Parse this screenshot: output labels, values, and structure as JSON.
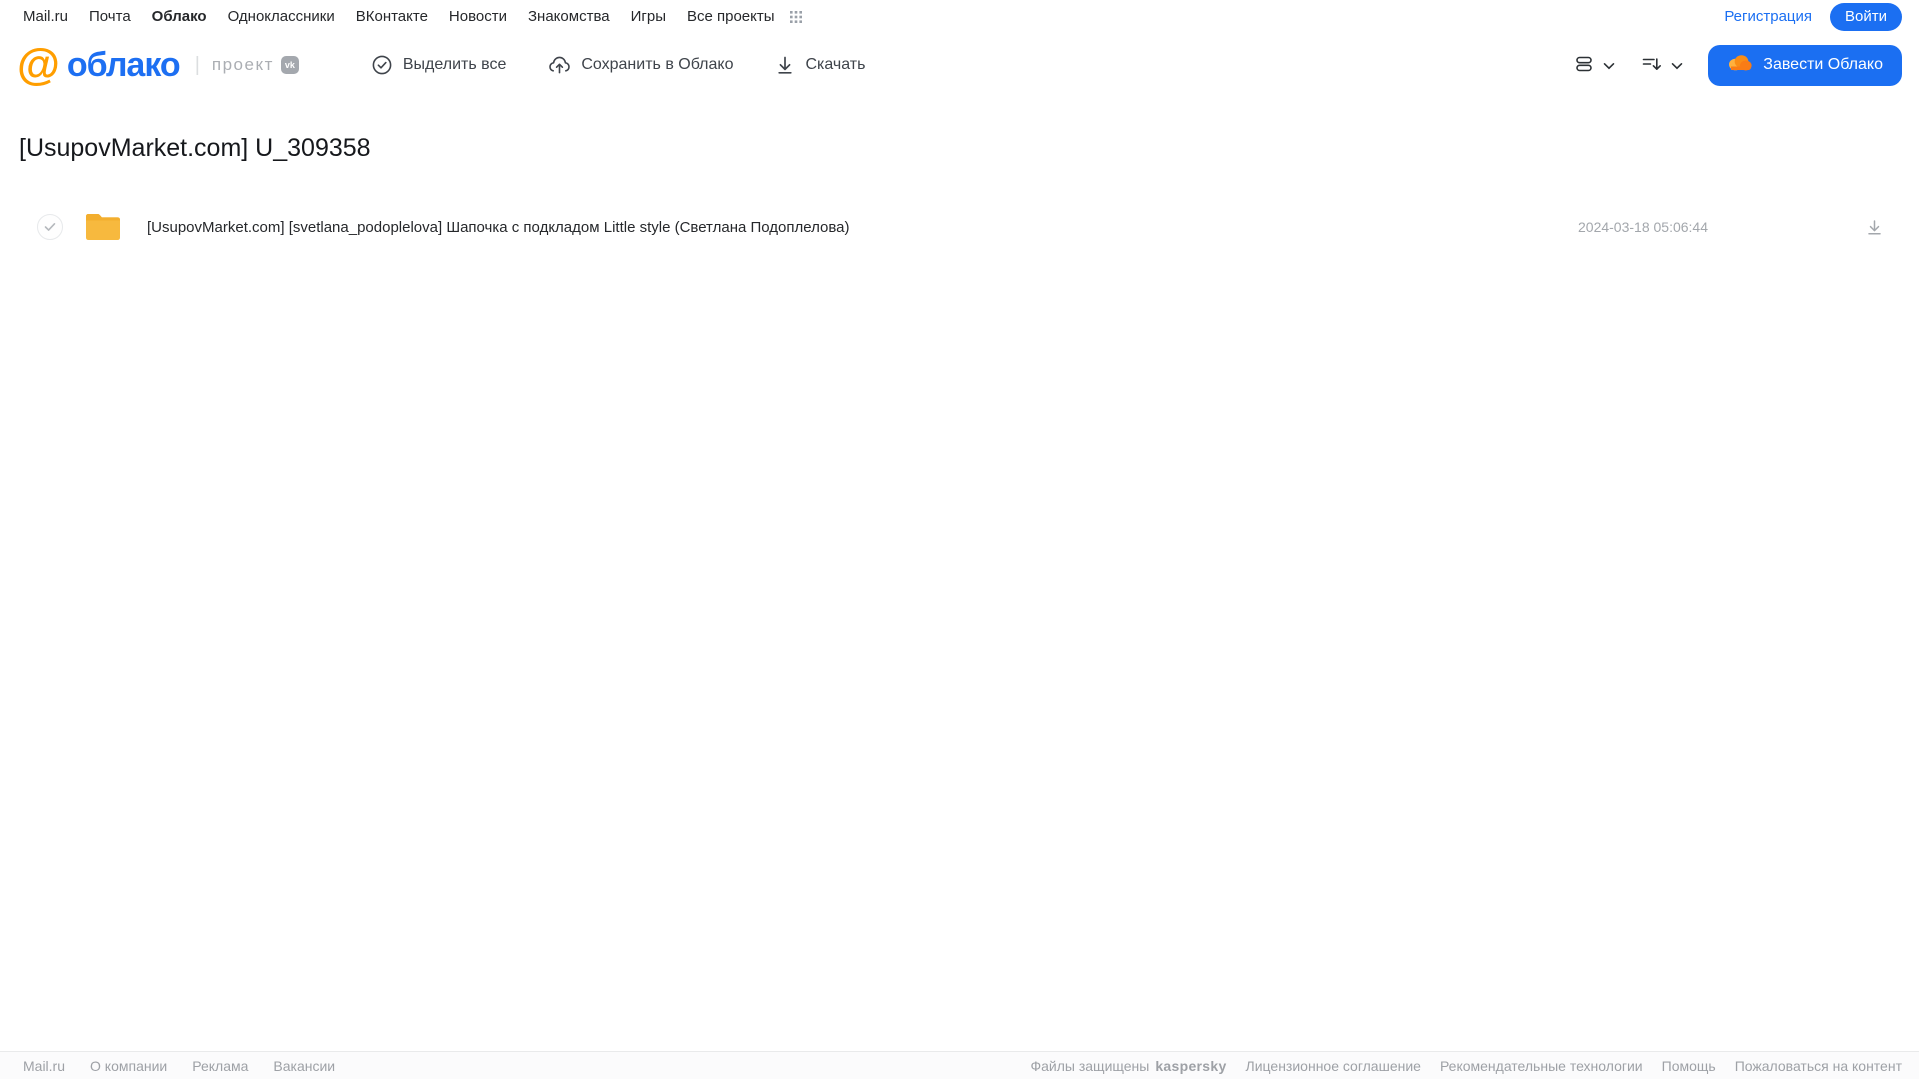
{
  "topnav": {
    "links": [
      "Mail.ru",
      "Почта",
      "Облако",
      "Одноклассники",
      "ВКонтакте",
      "Новости",
      "Знакомства",
      "Игры",
      "Все проекты"
    ],
    "registration_label": "Регистрация",
    "login_label": "Войти"
  },
  "header": {
    "logo_at": "@",
    "logo_text": "облако",
    "logo_divider": "|",
    "project_label": "проект",
    "vk_badge": "vk",
    "toolbar": {
      "select_all_label": "Выделить все",
      "save_to_cloud_label": "Сохранить в Облако",
      "download_label": "Скачать"
    },
    "create_cloud_label": "Завести Облако"
  },
  "page": {
    "title": "[UsupovMarket.com] U_309358"
  },
  "file_list": {
    "rows": [
      {
        "name": "[UsupovMarket.com] [svetlana_podoplelova] Шапочка с подкладом Little style (Светлана Подоплелова)",
        "date": "2024-03-18 05:06:44",
        "type": "folder"
      }
    ]
  },
  "footer": {
    "left_links": [
      "Mail.ru",
      "О компании",
      "Реклама",
      "Вакансии"
    ],
    "protected_label": "Файлы защищены",
    "kaspersky_label": "kaspersky",
    "right_links": [
      "Лицензионное соглашение",
      "Рекомендательные технологии",
      "Помощь",
      "Пожаловаться на контент"
    ]
  },
  "icons": {
    "grid": "all-projects-grid-icon",
    "check_circle": "select-all-check-circle-icon",
    "cloud_upload": "save-to-cloud-icon",
    "arrow_down": "download-arrow-icon",
    "view_toggle": "view-mode-icon",
    "sort": "sort-icon",
    "chevron": "chevron-down-icon",
    "cloud": "cloud-icon",
    "folder": "folder-icon"
  },
  "colors": {
    "accent_blue": "#1b6ff2",
    "logo_orange": "#ff9e00",
    "folder_yellow": "#f7b93e",
    "kaspersky_green": "#00a88e",
    "text_gray": "#9ea1a6"
  }
}
